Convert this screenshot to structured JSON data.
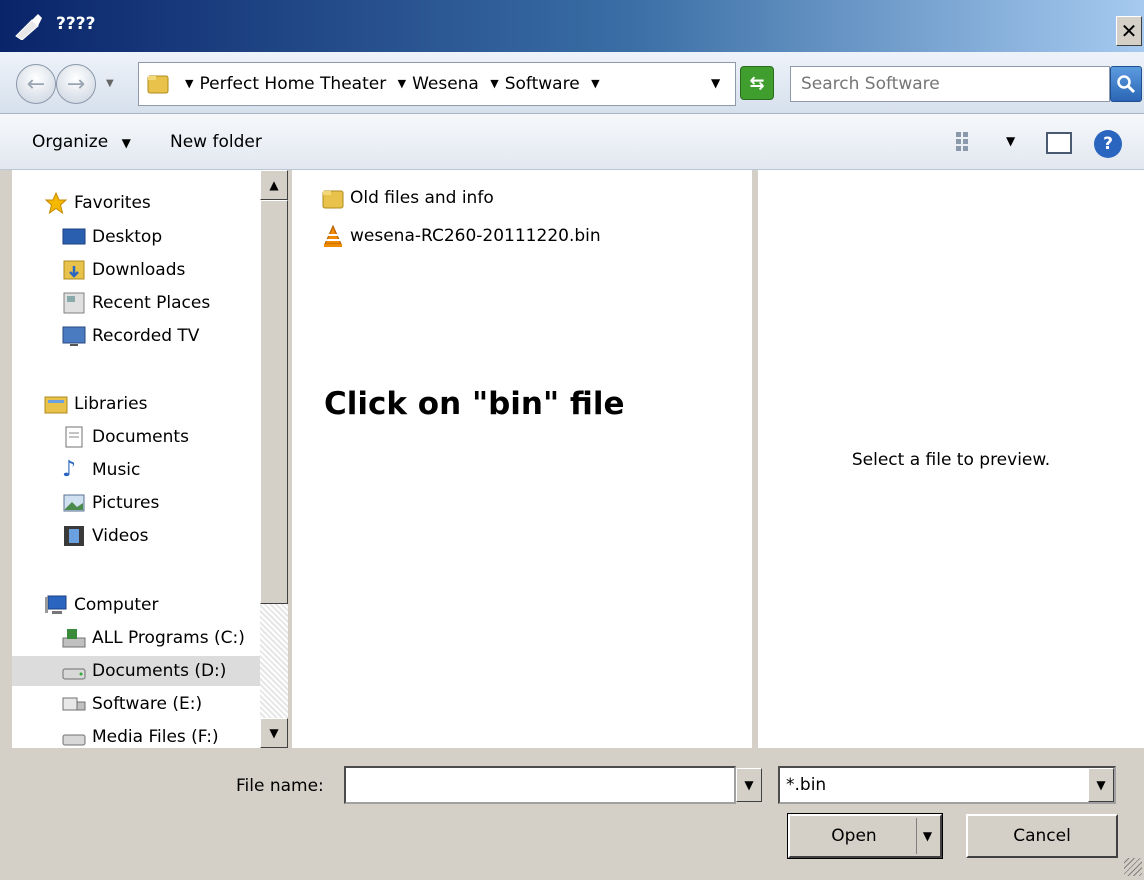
{
  "window": {
    "title": "????"
  },
  "address": {
    "crumbs": [
      "Perfect Home Theater",
      "Wesena",
      "Software"
    ]
  },
  "search": {
    "placeholder": "Search Software"
  },
  "toolbar": {
    "organize_label": "Organize",
    "new_folder_label": "New folder"
  },
  "nav": {
    "favorites": {
      "label": "Favorites",
      "items": [
        "Desktop",
        "Downloads",
        "Recent Places",
        "Recorded TV"
      ]
    },
    "libraries": {
      "label": "Libraries",
      "items": [
        "Documents",
        "Music",
        "Pictures",
        "Videos"
      ]
    },
    "computer": {
      "label": "Computer",
      "items": [
        "ALL Programs (C:)",
        "Documents (D:)",
        "Software (E:)",
        "Media Files (F:)"
      ]
    }
  },
  "files": [
    {
      "name": "Old files and info",
      "icon": "folder-icon"
    },
    {
      "name": "wesena-RC260-20111220.bin",
      "icon": "vlc-icon"
    }
  ],
  "instruction": "Click on \"bin\" file",
  "preview": {
    "text": "Select a file to preview."
  },
  "footer": {
    "file_name_label": "File name:",
    "file_name_value": "",
    "file_type": "*.bin",
    "open_label": "Open",
    "cancel_label": "Cancel"
  },
  "colors": {
    "title_bar": "#0a246a",
    "dialog_bg": "#d4d0c8",
    "refresh_green": "#3f9e2e"
  }
}
